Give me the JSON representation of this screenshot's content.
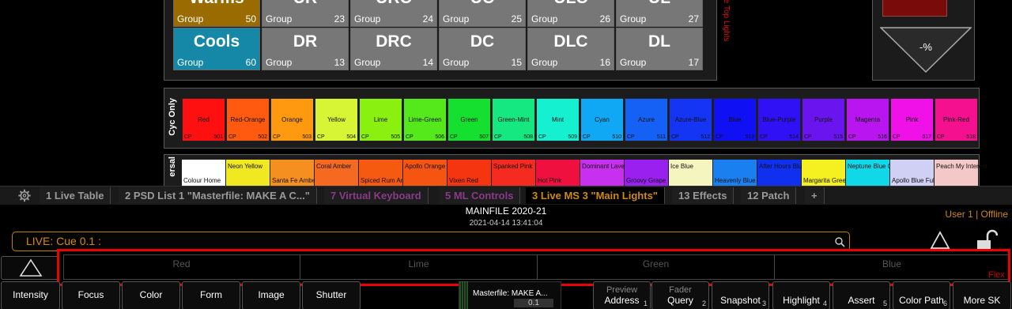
{
  "groups": [
    {
      "name": "Warms",
      "label": "Group",
      "num": "50",
      "color": "#9a6c00"
    },
    {
      "name": "UR",
      "label": "Group",
      "num": "23",
      "color": "#777777"
    },
    {
      "name": "URC",
      "label": "Group",
      "num": "24",
      "color": "#777777"
    },
    {
      "name": "UC",
      "label": "Group",
      "num": "25",
      "color": "#777777"
    },
    {
      "name": "ULC",
      "label": "Group",
      "num": "26",
      "color": "#777777"
    },
    {
      "name": "UL",
      "label": "Group",
      "num": "27",
      "color": "#777777"
    },
    {
      "name": "Cools",
      "label": "Group",
      "num": "60",
      "color": "#1588a8"
    },
    {
      "name": "DR",
      "label": "Group",
      "num": "13",
      "color": "#777777"
    },
    {
      "name": "DRC",
      "label": "Group",
      "num": "14",
      "color": "#777777"
    },
    {
      "name": "DC",
      "label": "Group",
      "num": "15",
      "color": "#777777"
    },
    {
      "name": "DLC",
      "label": "Group",
      "num": "16",
      "color": "#777777"
    },
    {
      "name": "DL",
      "label": "Group",
      "num": "17",
      "color": "#777777"
    }
  ],
  "group_panel_side_label": "te Top Lights",
  "percent_button": "-%",
  "cyc_label": "Cyc Only",
  "cp_label": "CP",
  "swatches": [
    {
      "name": "Red",
      "id": "501",
      "color": "#ff1010"
    },
    {
      "name": "Red-Orange",
      "id": "502",
      "color": "#ff5a10"
    },
    {
      "name": "Orange",
      "id": "503",
      "color": "#ff9a10"
    },
    {
      "name": "Yellow",
      "id": "504",
      "color": "#d8f535"
    },
    {
      "name": "Lime",
      "id": "505",
      "color": "#8af010"
    },
    {
      "name": "Lime-Green",
      "id": "506",
      "color": "#55e81a"
    },
    {
      "name": "Green",
      "id": "507",
      "color": "#15e030"
    },
    {
      "name": "Green-Mint",
      "id": "508",
      "color": "#15e880"
    },
    {
      "name": "Mint",
      "id": "509",
      "color": "#15f0d0"
    },
    {
      "name": "Cyan",
      "id": "510",
      "color": "#10a8f5"
    },
    {
      "name": "Azure",
      "id": "511",
      "color": "#1560f5"
    },
    {
      "name": "Azure-Blue",
      "id": "512",
      "color": "#1535f5"
    },
    {
      "name": "Blue",
      "id": "513",
      "color": "#1010f5"
    },
    {
      "name": "Blue-Purple",
      "id": "514",
      "color": "#3010f5"
    },
    {
      "name": "Purple",
      "id": "515",
      "color": "#6a15f0"
    },
    {
      "name": "Magenta",
      "id": "516",
      "color": "#b815f0"
    },
    {
      "name": "Pink",
      "id": "517",
      "color": "#f010e8"
    },
    {
      "name": "Pink-Red",
      "id": "518",
      "color": "#f51090"
    }
  ],
  "row2_label": "ersal",
  "swatches2": [
    {
      "name": "Colour Home",
      "pos": "bottom",
      "color": "#ffffff"
    },
    {
      "name": "Neon Yellow",
      "pos": "top",
      "color": "#f0e820"
    },
    {
      "name": "Santa Fe Amber",
      "pos": "bottom",
      "color": "#f59020"
    },
    {
      "name": "Coral Amber",
      "pos": "top",
      "color": "#f56a20"
    },
    {
      "name": "Spiced Rum Amber",
      "pos": "bottom",
      "color": "#f55a10"
    },
    {
      "name": "Apollo Orange",
      "pos": "top",
      "color": "#f55510"
    },
    {
      "name": "Vixen Red",
      "pos": "bottom",
      "color": "#f53510"
    },
    {
      "name": "Spanked Pink",
      "pos": "top",
      "color": "#f52a20"
    },
    {
      "name": "Hot Pink",
      "pos": "bottom",
      "color": "#f01040"
    },
    {
      "name": "Dominant Lavender",
      "pos": "top",
      "color": "#c830f0"
    },
    {
      "name": "Groovy Grape",
      "pos": "bottom",
      "color": "#9a20f0"
    },
    {
      "name": "Ice Blue",
      "pos": "top",
      "color": "#f5f5c0"
    },
    {
      "name": "Heavenly Blue",
      "pos": "bottom",
      "color": "#1a80f0"
    },
    {
      "name": "After Hours Blue",
      "pos": "top",
      "color": "#1030f0"
    },
    {
      "name": "Margarita Green",
      "pos": "bottom",
      "color": "#f5f020"
    },
    {
      "name": "Neptune Blue Green",
      "pos": "top",
      "color": "#10d8e8"
    },
    {
      "name": "Apollo Blue Full CTB",
      "pos": "bottom",
      "color": "#d0d0f5"
    },
    {
      "name": "Peach My Interest",
      "pos": "top",
      "color": "#f5c8c8"
    }
  ],
  "tabs": [
    {
      "label": "1 Live Table",
      "color": "#9a9a9a"
    },
    {
      "label": "2 PSD List 1 \"Masterfile: MAKE A C...\"",
      "color": "#9a9a9a"
    },
    {
      "label": "7 Virtual Keyboard",
      "color": "#8a3a8a"
    },
    {
      "label": "5 ML Controls",
      "color": "#8a3a8a"
    },
    {
      "label": "3 Live MS 3 \"Main Lights\"",
      "color": "#d08a10"
    },
    {
      "label": "13 Effects",
      "color": "#9a9a9a"
    },
    {
      "label": "12 Patch",
      "color": "#9a9a9a"
    },
    {
      "label": "+",
      "color": "#9a9a9a"
    }
  ],
  "header": {
    "title": "MAINFILE 2020-21",
    "date": "2021-04-14 13:41:04",
    "user": "User 1 | Offline"
  },
  "command_line": "LIVE: Cue  0.1 :",
  "params": [
    "Red",
    "Lime",
    "Green",
    "Blue"
  ],
  "flex_label": "Flex",
  "bottom_buttons": [
    "Intensity",
    "Focus",
    "Color",
    "Form",
    "Image",
    "Shutter"
  ],
  "fader": {
    "label": "Masterfile: MAKE A...",
    "value": "0.1"
  },
  "softkeys": [
    {
      "top": "Preview",
      "label": "Address",
      "key": "1"
    },
    {
      "top": "Fader",
      "label": "Query",
      "key": "2"
    },
    {
      "top": "",
      "label": "Snapshot",
      "key": "3"
    },
    {
      "top": "",
      "label": "Highlight",
      "key": "4"
    },
    {
      "top": "",
      "label": "Assert",
      "key": "5"
    },
    {
      "top": "",
      "label": "Color Path",
      "key": "6"
    },
    {
      "top": "",
      "label": "More SK",
      "key": ""
    }
  ]
}
